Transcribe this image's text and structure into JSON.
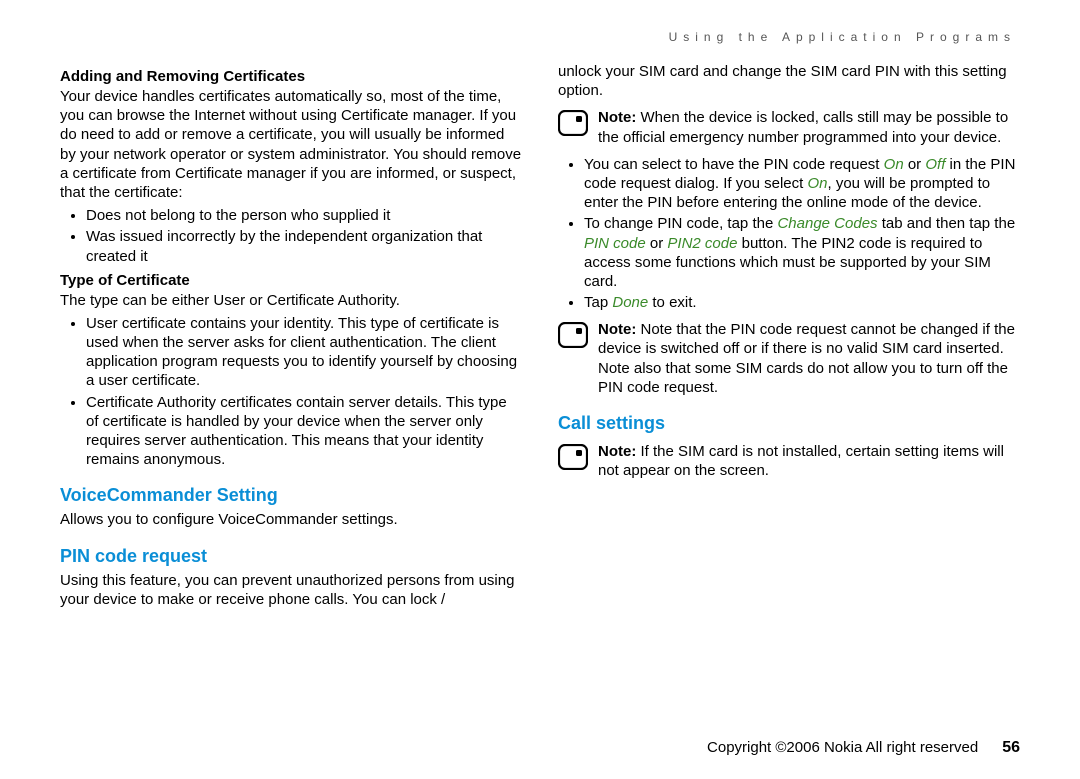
{
  "runningHeader": "Using the Application Programs",
  "left": {
    "h1": "Adding and Removing Certificates",
    "p1": "Your device handles certificates automatically so, most of the time, you can browse the Internet without using Certificate manager. If you do need to add or remove a certificate, you will usually be informed by your network operator or system administrator. You should remove a certificate from Certificate manager if you are informed, or suspect, that the certificate:",
    "bul1a": "Does not belong to the person who supplied it",
    "bul1b": "Was issued incorrectly by the independent organization that created it",
    "h2": "Type of Certificate",
    "p2": "The type can be either User or Certificate Authority.",
    "bul2a": "User certificate contains your identity. This type of certificate is used when the server asks for client authentication. The client application program requests you to identify yourself by choosing a user certificate.",
    "bul2b": "Certificate Authority certificates contain server details. This type of certificate is handled by your device when the server only requires server authentication. This means that your identity remains anonymous.",
    "sec1": "VoiceCommander Setting",
    "p3": "Allows you to configure VoiceCommander settings.",
    "sec2": "PIN code request",
    "p4": "Using this feature, you can prevent unauthorized persons from using your device to make or receive phone calls. You can lock /"
  },
  "right": {
    "p1": "unlock your SIM card and change the SIM card PIN with this setting option.",
    "note1_label": "Note:",
    "note1": " When the device is locked, calls still may be possible to the official emergency number programmed into your device.",
    "bul1_pre": "You can select to have the PIN code request ",
    "on": "On",
    "or1": " or ",
    "off": "Off",
    "bul1_mid": " in the PIN code request dialog. If you select ",
    "on2": "On",
    "bul1_post": ", you will be prompted to enter the PIN before entering the online mode of the device.",
    "bul2_pre": "To change PIN code, tap the ",
    "changeCodes": "Change Codes",
    "bul2_mid": " tab and then tap the ",
    "pinCode": "PIN code",
    "or2": " or ",
    "pin2Code": "PIN2 code",
    "bul2_post": " button. The PIN2 code is required to access some functions which must be supported by your SIM card.",
    "bul3_pre": "Tap ",
    "done": "Done",
    "bul3_post": " to exit.",
    "note2_label": "Note:",
    "note2": " Note that the PIN code request cannot be changed if the device is switched off or if there is no valid SIM card inserted. Note also that some SIM cards do not allow you to turn off the PIN code request.",
    "sec1": "Call settings",
    "note3_label": "Note:",
    "note3": " If the SIM card is not installed, certain setting items will not appear on the screen."
  },
  "footer": {
    "copyright": "Copyright ©2006 Nokia All right reserved",
    "page": "56"
  }
}
